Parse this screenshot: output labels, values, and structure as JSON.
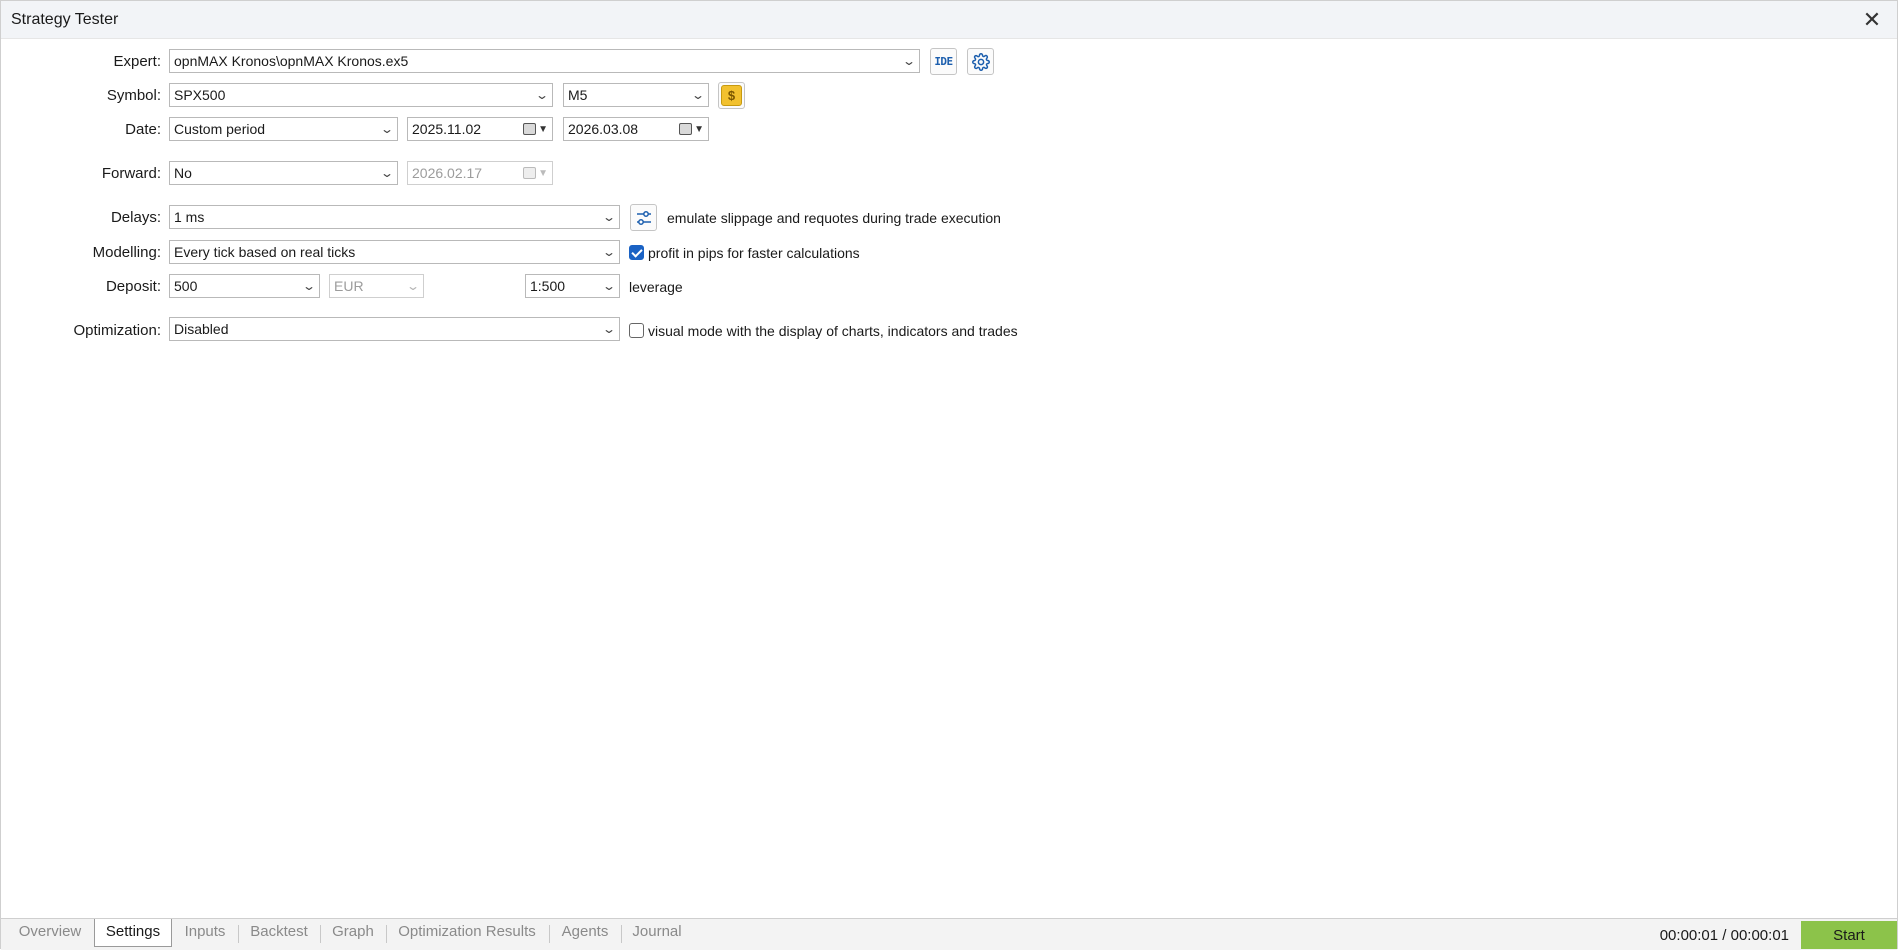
{
  "window": {
    "title": "Strategy Tester"
  },
  "settings": {
    "expert": {
      "label": "Expert:",
      "value": "opnMAX Kronos\\opnMAX Kronos.ex5",
      "ide_label": "IDE"
    },
    "symbol": {
      "label": "Symbol:",
      "value": "SPX500",
      "timeframe": "M5",
      "coin_glyph": "$"
    },
    "date": {
      "label": "Date:",
      "period": "Custom period",
      "from": "2025.11.02",
      "to": "2026.03.08"
    },
    "forward": {
      "label": "Forward:",
      "value": "No",
      "date": "2026.02.17"
    },
    "delays": {
      "label": "Delays:",
      "value": "1 ms",
      "note": "emulate slippage and requotes during trade execution"
    },
    "modelling": {
      "label": "Modelling:",
      "value": "Every tick based on real ticks",
      "pips_checkbox": {
        "checked": true,
        "label": "profit in pips for faster calculations"
      }
    },
    "deposit": {
      "label": "Deposit:",
      "value": "500",
      "currency": "EUR",
      "leverage": "1:500",
      "leverage_label": "leverage"
    },
    "optimization": {
      "label": "Optimization:",
      "value": "Disabled",
      "visual_checkbox": {
        "checked": false,
        "label": "visual mode with the display of charts, indicators and trades"
      }
    }
  },
  "tabs": [
    {
      "label": "Overview",
      "active": false
    },
    {
      "label": "Settings",
      "active": true
    },
    {
      "label": "Inputs",
      "active": false
    },
    {
      "label": "Backtest",
      "active": false
    },
    {
      "label": "Graph",
      "active": false
    },
    {
      "label": "Optimization Results",
      "active": false
    },
    {
      "label": "Agents",
      "active": false
    },
    {
      "label": "Journal",
      "active": false
    }
  ],
  "status": {
    "timer": "00:00:01 / 00:00:01",
    "start_label": "Start"
  },
  "colors": {
    "start_button": "#8cc34a",
    "checkbox_on": "#1a62c4",
    "ide_text": "#1d5fae",
    "coin": "#f2c12e"
  },
  "icons": {
    "close": "close-icon",
    "settings": "gear-icon",
    "delays_settings": "sliders-icon",
    "symbol_spec": "dollar-coin-icon"
  }
}
